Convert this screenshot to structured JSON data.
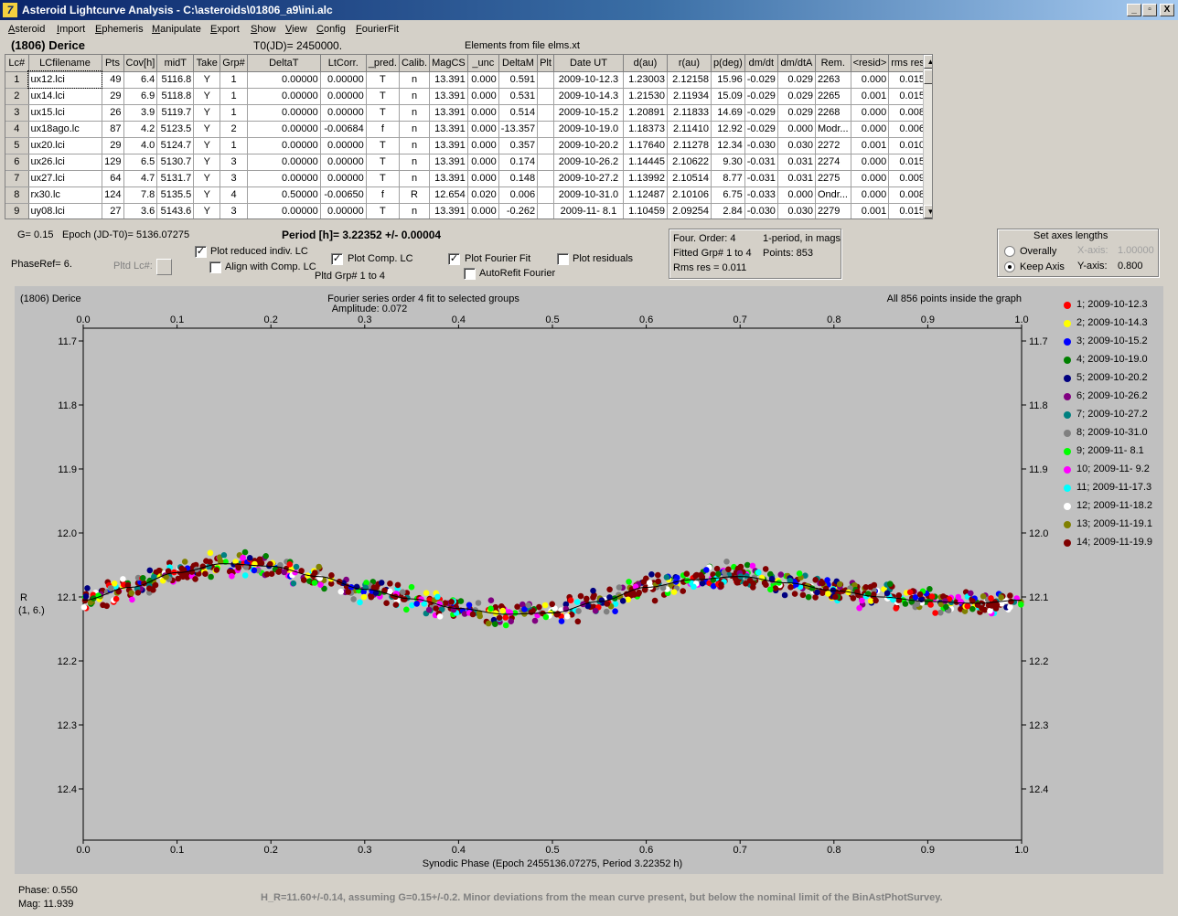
{
  "window": {
    "title": "Asteroid Lightcurve Analysis - C:\\asteroids\\01806_a9\\ini.alc",
    "min_btn": "_",
    "max_btn": "▫",
    "close_btn": "X"
  },
  "menu": [
    "Asteroid",
    "Import",
    "Ephemeris",
    "Manipulate",
    "Export",
    "Show",
    "View",
    "Config",
    "FourierFit"
  ],
  "info": {
    "asteroid_name": "(1806) Derice",
    "t0": "T0(JD)= 2450000.",
    "elements": "Elements from file elms.xt"
  },
  "table": {
    "headers": [
      "Lc#",
      "LCfilename",
      "Pts",
      "Cov[h]",
      "midT",
      "Take",
      "Grp#",
      "DeltaT",
      "LtCorr.",
      "_pred.",
      "Calib.",
      "MagCS",
      "_unc",
      "DeltaM",
      "Plt",
      "Date UT",
      "d(au)",
      "r(au)",
      "p(deg)",
      "dm/dt",
      "dm/dtA",
      "Rem.",
      "<resid>",
      "rms res"
    ],
    "rows": [
      [
        "1",
        "ux12.lci",
        "49",
        "6.4",
        "5116.8",
        "Y",
        "1",
        "0.00000",
        "0.00000",
        "T",
        "n",
        "13.391",
        "0.000",
        "0.591",
        "",
        "2009-10-12.3",
        "1.23003",
        "2.12158",
        "15.96",
        "-0.029",
        "0.029",
        "2263",
        "0.000",
        "0.015"
      ],
      [
        "2",
        "ux14.lci",
        "29",
        "6.9",
        "5118.8",
        "Y",
        "1",
        "0.00000",
        "0.00000",
        "T",
        "n",
        "13.391",
        "0.000",
        "0.531",
        "",
        "2009-10-14.3",
        "1.21530",
        "2.11934",
        "15.09",
        "-0.029",
        "0.029",
        "2265",
        "0.001",
        "0.015"
      ],
      [
        "3",
        "ux15.lci",
        "26",
        "3.9",
        "5119.7",
        "Y",
        "1",
        "0.00000",
        "0.00000",
        "T",
        "n",
        "13.391",
        "0.000",
        "0.514",
        "",
        "2009-10-15.2",
        "1.20891",
        "2.11833",
        "14.69",
        "-0.029",
        "0.029",
        "2268",
        "0.000",
        "0.008"
      ],
      [
        "4",
        "ux18ago.lc",
        "87",
        "4.2",
        "5123.5",
        "Y",
        "2",
        "0.00000",
        "-0.00684",
        "f",
        "n",
        "13.391",
        "0.000",
        "-13.357",
        "",
        "2009-10-19.0",
        "1.18373",
        "2.11410",
        "12.92",
        "-0.029",
        "0.000",
        "Modr...",
        "0.000",
        "0.006"
      ],
      [
        "5",
        "ux20.lci",
        "29",
        "4.0",
        "5124.7",
        "Y",
        "1",
        "0.00000",
        "0.00000",
        "T",
        "n",
        "13.391",
        "0.000",
        "0.357",
        "",
        "2009-10-20.2",
        "1.17640",
        "2.11278",
        "12.34",
        "-0.030",
        "0.030",
        "2272",
        "0.001",
        "0.010"
      ],
      [
        "6",
        "ux26.lci",
        "129",
        "6.5",
        "5130.7",
        "Y",
        "3",
        "0.00000",
        "0.00000",
        "T",
        "n",
        "13.391",
        "0.000",
        "0.174",
        "",
        "2009-10-26.2",
        "1.14445",
        "2.10622",
        "9.30",
        "-0.031",
        "0.031",
        "2274",
        "0.000",
        "0.015"
      ],
      [
        "7",
        "ux27.lci",
        "64",
        "4.7",
        "5131.7",
        "Y",
        "3",
        "0.00000",
        "0.00000",
        "T",
        "n",
        "13.391",
        "0.000",
        "0.148",
        "",
        "2009-10-27.2",
        "1.13992",
        "2.10514",
        "8.77",
        "-0.031",
        "0.031",
        "2275",
        "0.000",
        "0.009"
      ],
      [
        "8",
        "rx30.lc",
        "124",
        "7.8",
        "5135.5",
        "Y",
        "4",
        "0.50000",
        "-0.00650",
        "f",
        "R",
        "12.654",
        "0.020",
        "0.006",
        "",
        "2009-10-31.0",
        "1.12487",
        "2.10106",
        "6.75",
        "-0.033",
        "0.000",
        "Ondr...",
        "0.000",
        "0.008"
      ],
      [
        "9",
        "uy08.lci",
        "27",
        "3.6",
        "5143.6",
        "Y",
        "3",
        "0.00000",
        "0.00000",
        "T",
        "n",
        "13.391",
        "0.000",
        "-0.262",
        "",
        "2009-11- 8.1",
        "1.10459",
        "2.09254",
        "2.84",
        "-0.030",
        "0.030",
        "2279",
        "0.001",
        "0.015"
      ]
    ]
  },
  "controls": {
    "g_value": "G= 0.15",
    "epoch": "Epoch (JD-T0)= 5136.07275",
    "period": "Period [h]= 3.22352 +/- 0.00004",
    "phaseref": "PhaseRef= 6.",
    "pltd_lc": "Pltd Lc#:",
    "plot_reduced": "Plot reduced indiv. LC",
    "align_comp": "Align with Comp. LC",
    "plot_comp": "Plot Comp. LC",
    "pltd_grp": "Pltd Grp#  1   to   4",
    "plot_fourier": "Plot Fourier Fit",
    "autorefit": "AutoRefit Fourier",
    "plot_residuals": "Plot residuals",
    "check_mark": "✓",
    "plot_reduced_checked": true,
    "align_comp_checked": false,
    "plot_comp_checked": true,
    "plot_fourier_checked": true,
    "autorefit_checked": false,
    "plot_residuals_checked": false
  },
  "fit_info": {
    "four_order": "Four. Order:  4",
    "one_period": "1-period, in mags",
    "fitted_grp": "Fitted Grp# 1 to 4",
    "points": "Points: 853",
    "rms_res": "Rms res     = 0.011"
  },
  "axes_box": {
    "title": "Set axes lengths",
    "overally": "Overally",
    "keep_axis": "Keep Axis",
    "x_axis_label": "X-axis:",
    "x_axis_value": "1.00000",
    "y_axis_label": "Y-axis:",
    "y_axis_value": "0.800",
    "selected": "keep_axis"
  },
  "plot": {
    "name": "(1806) Derice",
    "fourier_title": "Fourier series order 4 fit to selected groups",
    "amplitude": "Amplitude: 0.072",
    "points_inside": "All 856 points inside the graph",
    "ylabel_line1": "R",
    "ylabel_line2": "(1, 6.)",
    "xlabel": "Synodic Phase (Epoch 2455136.07275, Period 3.22352 h)",
    "background": "#c0c0c0"
  },
  "chart_data": {
    "type": "scatter",
    "x_range": [
      0.0,
      1.0
    ],
    "y_range": [
      11.68,
      12.48
    ],
    "y_inverted": true,
    "x_ticks": [
      "0.0",
      "0.1",
      "0.2",
      "0.3",
      "0.4",
      "0.5",
      "0.6",
      "0.7",
      "0.8",
      "0.9",
      "1.0"
    ],
    "y_ticks": [
      "11.7",
      "11.8",
      "11.9",
      "12.0",
      "12.1",
      "12.2",
      "12.3",
      "12.4"
    ],
    "fourier_fit": {
      "x": [
        0.0,
        0.05,
        0.1,
        0.15,
        0.2,
        0.25,
        0.3,
        0.35,
        0.4,
        0.45,
        0.5,
        0.55,
        0.6,
        0.65,
        0.7,
        0.75,
        0.8,
        0.85,
        0.9,
        0.95,
        1.0
      ],
      "y": [
        12.105,
        12.085,
        12.062,
        12.048,
        12.052,
        12.068,
        12.088,
        12.103,
        12.118,
        12.127,
        12.125,
        12.107,
        12.085,
        12.073,
        12.068,
        12.078,
        12.09,
        12.1,
        12.107,
        12.11,
        12.105
      ]
    },
    "series": [
      {
        "name": "1; 2009-10-12.3",
        "color": "#ff0000"
      },
      {
        "name": "2; 2009-10-14.3",
        "color": "#ffff00"
      },
      {
        "name": "3; 2009-10-15.2",
        "color": "#0000ff"
      },
      {
        "name": "4; 2009-10-19.0",
        "color": "#008000"
      },
      {
        "name": "5; 2009-10-20.2",
        "color": "#000080"
      },
      {
        "name": "6; 2009-10-26.2",
        "color": "#800080"
      },
      {
        "name": "7; 2009-10-27.2",
        "color": "#008080"
      },
      {
        "name": "8; 2009-10-31.0",
        "color": "#808080"
      },
      {
        "name": "9; 2009-11- 8.1",
        "color": "#00ff00"
      },
      {
        "name": "10; 2009-11- 9.2",
        "color": "#ff00ff"
      },
      {
        "name": "11; 2009-11-17.3",
        "color": "#00ffff"
      },
      {
        "name": "12; 2009-11-18.2",
        "color": "#ffffff"
      },
      {
        "name": "13; 2009-11-19.1",
        "color": "#808000"
      },
      {
        "name": "14; 2009-11-19.9",
        "color": "#800000"
      }
    ],
    "points_total": 856
  },
  "footer": {
    "phase": "Phase:  0.550",
    "mag": "Mag:    11.939",
    "summary": "H_R=11.60+/-0.14, assuming G=0.15+/-0.2. Minor deviations from the mean curve present, but below the nominal limit of the BinAstPhotSurvey."
  }
}
